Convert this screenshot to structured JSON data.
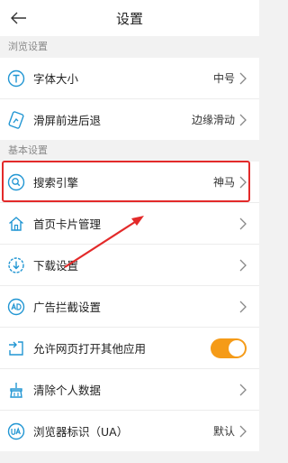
{
  "header": {
    "title": "设置"
  },
  "sections": {
    "browse": "浏览设置",
    "basic": "基本设置"
  },
  "rows": {
    "font_size": {
      "label": "字体大小",
      "value": "中号"
    },
    "swipe_nav": {
      "label": "滑屏前进后退",
      "value": "边缘滑动"
    },
    "search_engine": {
      "label": "搜索引擎",
      "value": "神马"
    },
    "homepage_cards": {
      "label": "首页卡片管理"
    },
    "download": {
      "label": "下载设置"
    },
    "ad_block": {
      "label": "广告拦截设置"
    },
    "allow_open_apps": {
      "label": "允许网页打开其他应用",
      "toggle": "on"
    },
    "clear_data": {
      "label": "清除个人数据"
    },
    "user_agent": {
      "label": "浏览器标识（UA）",
      "value": "默认"
    }
  },
  "colors": {
    "accent": "#2196d3",
    "toggle_on": "#f59b18",
    "highlight": "#e32a2a"
  }
}
